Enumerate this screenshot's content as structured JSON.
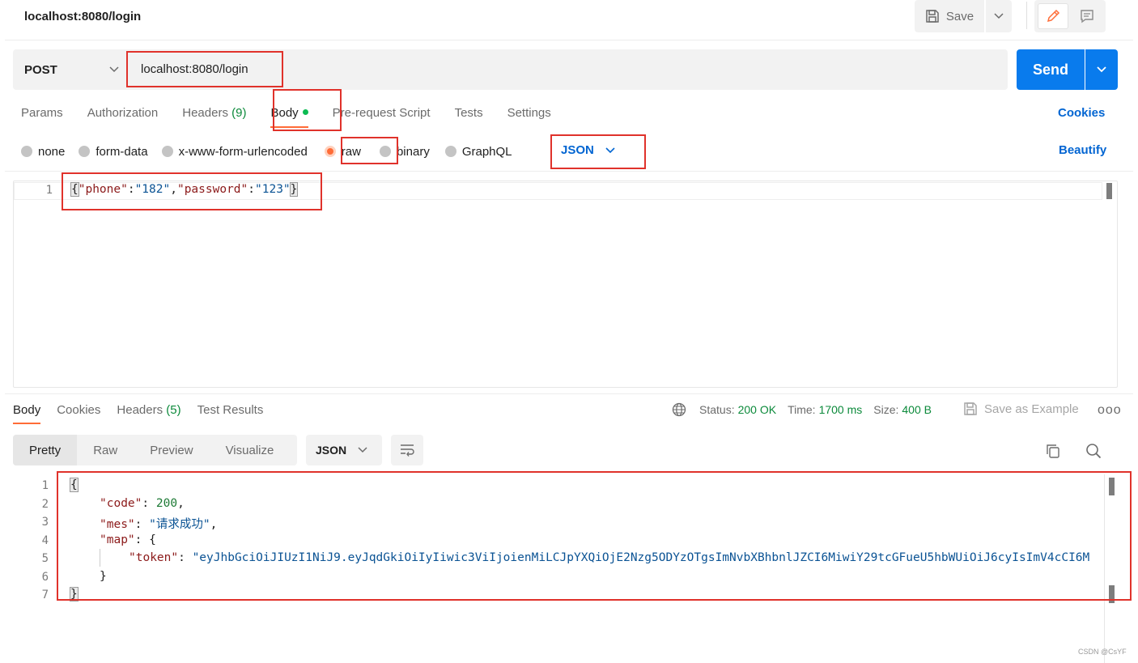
{
  "tab": {
    "title": "localhost:8080/login"
  },
  "toolbar": {
    "save_label": "Save"
  },
  "request": {
    "method": "POST",
    "url": "localhost:8080/login",
    "send_label": "Send"
  },
  "request_tabs": {
    "params": "Params",
    "authorization": "Authorization",
    "headers": "Headers",
    "headers_count": "(9)",
    "body": "Body",
    "pre_request": "Pre-request Script",
    "tests": "Tests",
    "settings": "Settings",
    "cookies": "Cookies"
  },
  "body_types": {
    "none": "none",
    "form_data": "form-data",
    "urlencoded": "x-www-form-urlencoded",
    "raw": "raw",
    "binary": "binary",
    "graphql": "GraphQL",
    "selected_language": "JSON",
    "beautify": "Beautify"
  },
  "request_body": {
    "line": "1",
    "open": "{",
    "k1": "\"phone\"",
    "v1": "\"182\"",
    "k2": "\"password\"",
    "v2": "\"123\"",
    "close": "}",
    "sep1": ":",
    "sep2": ",",
    "sep3": ":"
  },
  "response_tabs": {
    "body": "Body",
    "cookies": "Cookies",
    "headers": "Headers",
    "headers_count": "(5)",
    "test_results": "Test Results"
  },
  "response_status": {
    "status_label": "Status:",
    "status_value": "200 OK",
    "time_label": "Time:",
    "time_value": "1700 ms",
    "size_label": "Size:",
    "size_value": "400 B",
    "save_example": "Save as Example",
    "more": "ooo"
  },
  "view_tabs": {
    "pretty": "Pretty",
    "raw": "Raw",
    "preview": "Preview",
    "visualize": "Visualize",
    "format": "JSON"
  },
  "response_body": {
    "lines": [
      "1",
      "2",
      "3",
      "4",
      "5",
      "6",
      "7"
    ],
    "open": "{",
    "code_key": "\"code\"",
    "code_val": "200",
    "mes_key": "\"mes\"",
    "mes_val": "\"请求成功\"",
    "map_key": "\"map\"",
    "map_open": "{",
    "token_key": "\"token\"",
    "token_val": "\"eyJhbGciOiJIUzI1NiJ9.eyJqdGkiOiIyIiwic3ViIjoienMiLCJpYXQiOjE2Nzg5ODYzOTgsImNvbXBhbnlJZCI6MiwiY29tcGFueU5hbWUiOiJ6cyIsImV4cCI6M",
    "map_close": "}",
    "close": "}",
    "colon": ":",
    "comma": ","
  },
  "watermark": "CSDN @CsYF",
  "colors": {
    "accent": "#ff6c37",
    "send": "#097bed",
    "link": "#0265d2",
    "success": "#0c8a3b",
    "annotation": "#e0322b"
  }
}
